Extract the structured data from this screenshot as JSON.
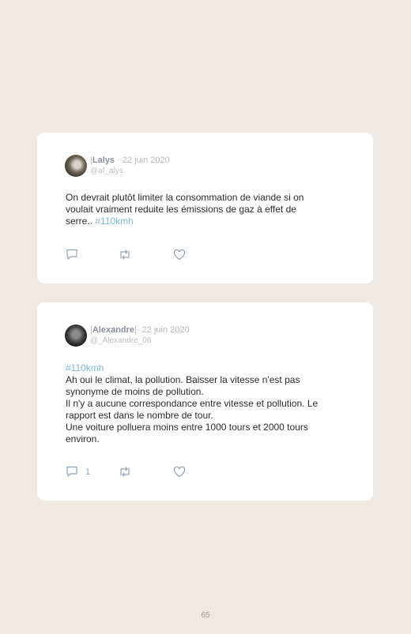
{
  "posts": [
    {
      "bar_left": "|",
      "name": "Lalys",
      "bar_right": "",
      "date": "· 22 juin 2020",
      "handle": "@af_alys",
      "lines": [
        "On devrait plutôt limiter la consommation de viande si on",
        "voulait vraiment reduite les émissions de gaz à effet de"
      ],
      "last_line_text": "serre.. ",
      "last_line_tag": "#110kmh",
      "reply_count": "",
      "icons": [
        "reply-icon",
        "retweet-icon",
        "heart-icon"
      ]
    },
    {
      "bar_left": "|",
      "name": "Alexandre",
      "bar_right": "|",
      "date": "· 22 juin 2020",
      "handle": "@_Alexandre_06",
      "tag": "#110kmh",
      "lines": [
        "Ah oui le climat, la pollution. Baisser la vitesse n'est pas",
        "synonyme de moins de pollution.",
        "Il n'y a aucune correspondance entre vitesse et pollution. Le",
        "rapport est dans le nombre de tour.",
        "Une voiture polluera moins entre 1000 tours et 2000 tours",
        "environ."
      ],
      "reply_count": "1",
      "icons": [
        "reply-icon",
        "retweet-icon",
        "heart-icon"
      ]
    }
  ],
  "page_number": "65",
  "colors": {
    "background": "#efe8e3",
    "card": "#ffffff",
    "hashtag": "#7fb7dc",
    "icon": "#8fa3b3"
  }
}
